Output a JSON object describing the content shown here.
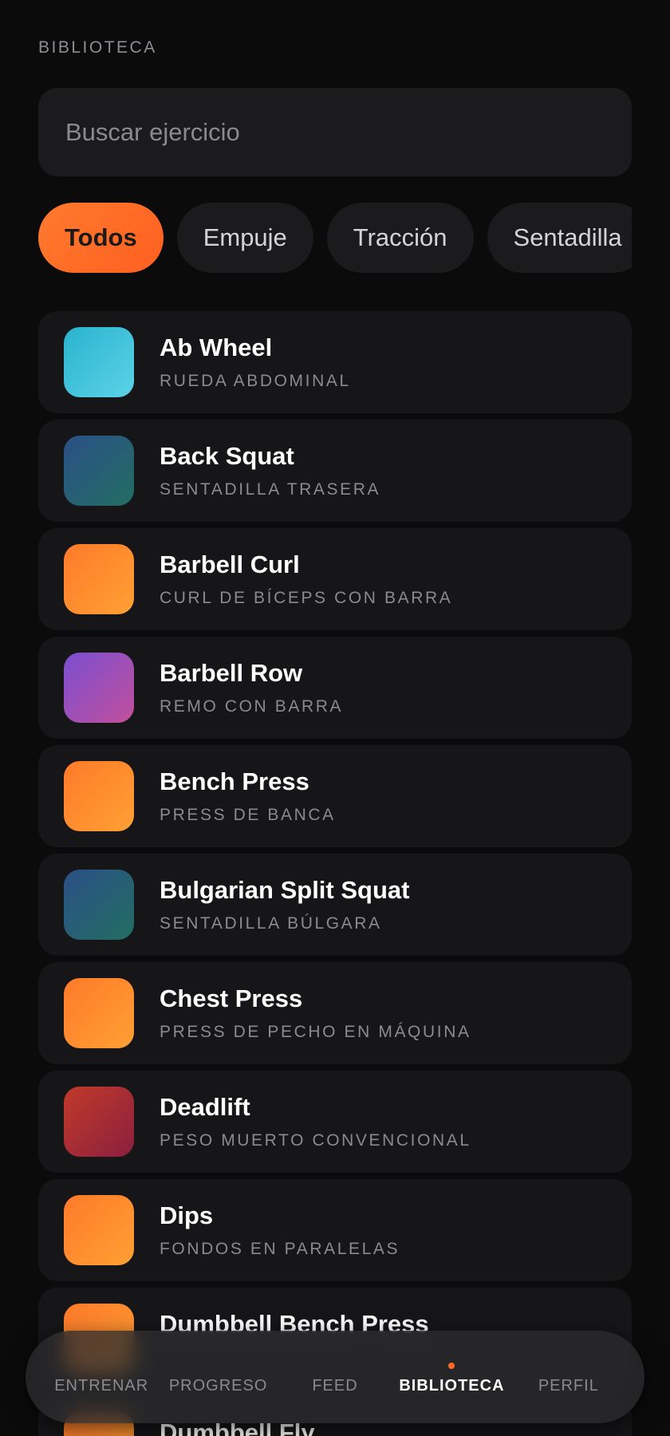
{
  "header": {
    "section_label": "BIBLIOTECA"
  },
  "search": {
    "placeholder": "Buscar ejercicio",
    "value": ""
  },
  "filters": [
    {
      "label": "Todos",
      "active": true
    },
    {
      "label": "Empuje",
      "active": false
    },
    {
      "label": "Tracción",
      "active": false
    },
    {
      "label": "Sentadilla",
      "active": false
    }
  ],
  "exercises": [
    {
      "name": "Ab Wheel",
      "subtitle": "RUEDA ABDOMINAL",
      "colors": [
        "#2bb3cf",
        "#5ad3e6"
      ]
    },
    {
      "name": "Back Squat",
      "subtitle": "SENTADILLA TRASERA",
      "colors": [
        "#2b4f86",
        "#226e62"
      ]
    },
    {
      "name": "Barbell Curl",
      "subtitle": "CURL DE BÍCEPS CON BARRA",
      "colors": [
        "#ff7a2a",
        "#ffa033"
      ]
    },
    {
      "name": "Barbell Row",
      "subtitle": "REMO CON BARRA",
      "colors": [
        "#7a4fd0",
        "#c24f9c"
      ]
    },
    {
      "name": "Bench Press",
      "subtitle": "PRESS DE BANCA",
      "colors": [
        "#ff7a2a",
        "#ffa033"
      ]
    },
    {
      "name": "Bulgarian Split Squat",
      "subtitle": "SENTADILLA BÚLGARA",
      "colors": [
        "#2b4f86",
        "#226e62"
      ]
    },
    {
      "name": "Chest Press",
      "subtitle": "PRESS DE PECHO EN MÁQUINA",
      "colors": [
        "#ff7a2a",
        "#ffa033"
      ]
    },
    {
      "name": "Deadlift",
      "subtitle": "PESO MUERTO CONVENCIONAL",
      "colors": [
        "#c23a2a",
        "#8a1f3f"
      ]
    },
    {
      "name": "Dips",
      "subtitle": "FONDOS EN PARALELAS",
      "colors": [
        "#ff7a2a",
        "#ffa033"
      ]
    },
    {
      "name": "Dumbbell Bench Press",
      "subtitle": "",
      "colors": [
        "#ff7a2a",
        "#ffa033"
      ]
    },
    {
      "name": "Dumbbell Fly",
      "subtitle": "",
      "colors": [
        "#ff7a2a",
        "#ffa033"
      ]
    }
  ],
  "bottom_nav": [
    {
      "label": "ENTRENAR",
      "active": false
    },
    {
      "label": "PROGRESO",
      "active": false
    },
    {
      "label": "FEED",
      "active": false
    },
    {
      "label": "BIBLIOTECA",
      "active": true
    },
    {
      "label": "PERFIL",
      "active": false
    }
  ],
  "colors": {
    "background": "#0b0b0c",
    "card": "#161618",
    "accent": "#ff6a2a",
    "muted": "#8a8a8f"
  }
}
